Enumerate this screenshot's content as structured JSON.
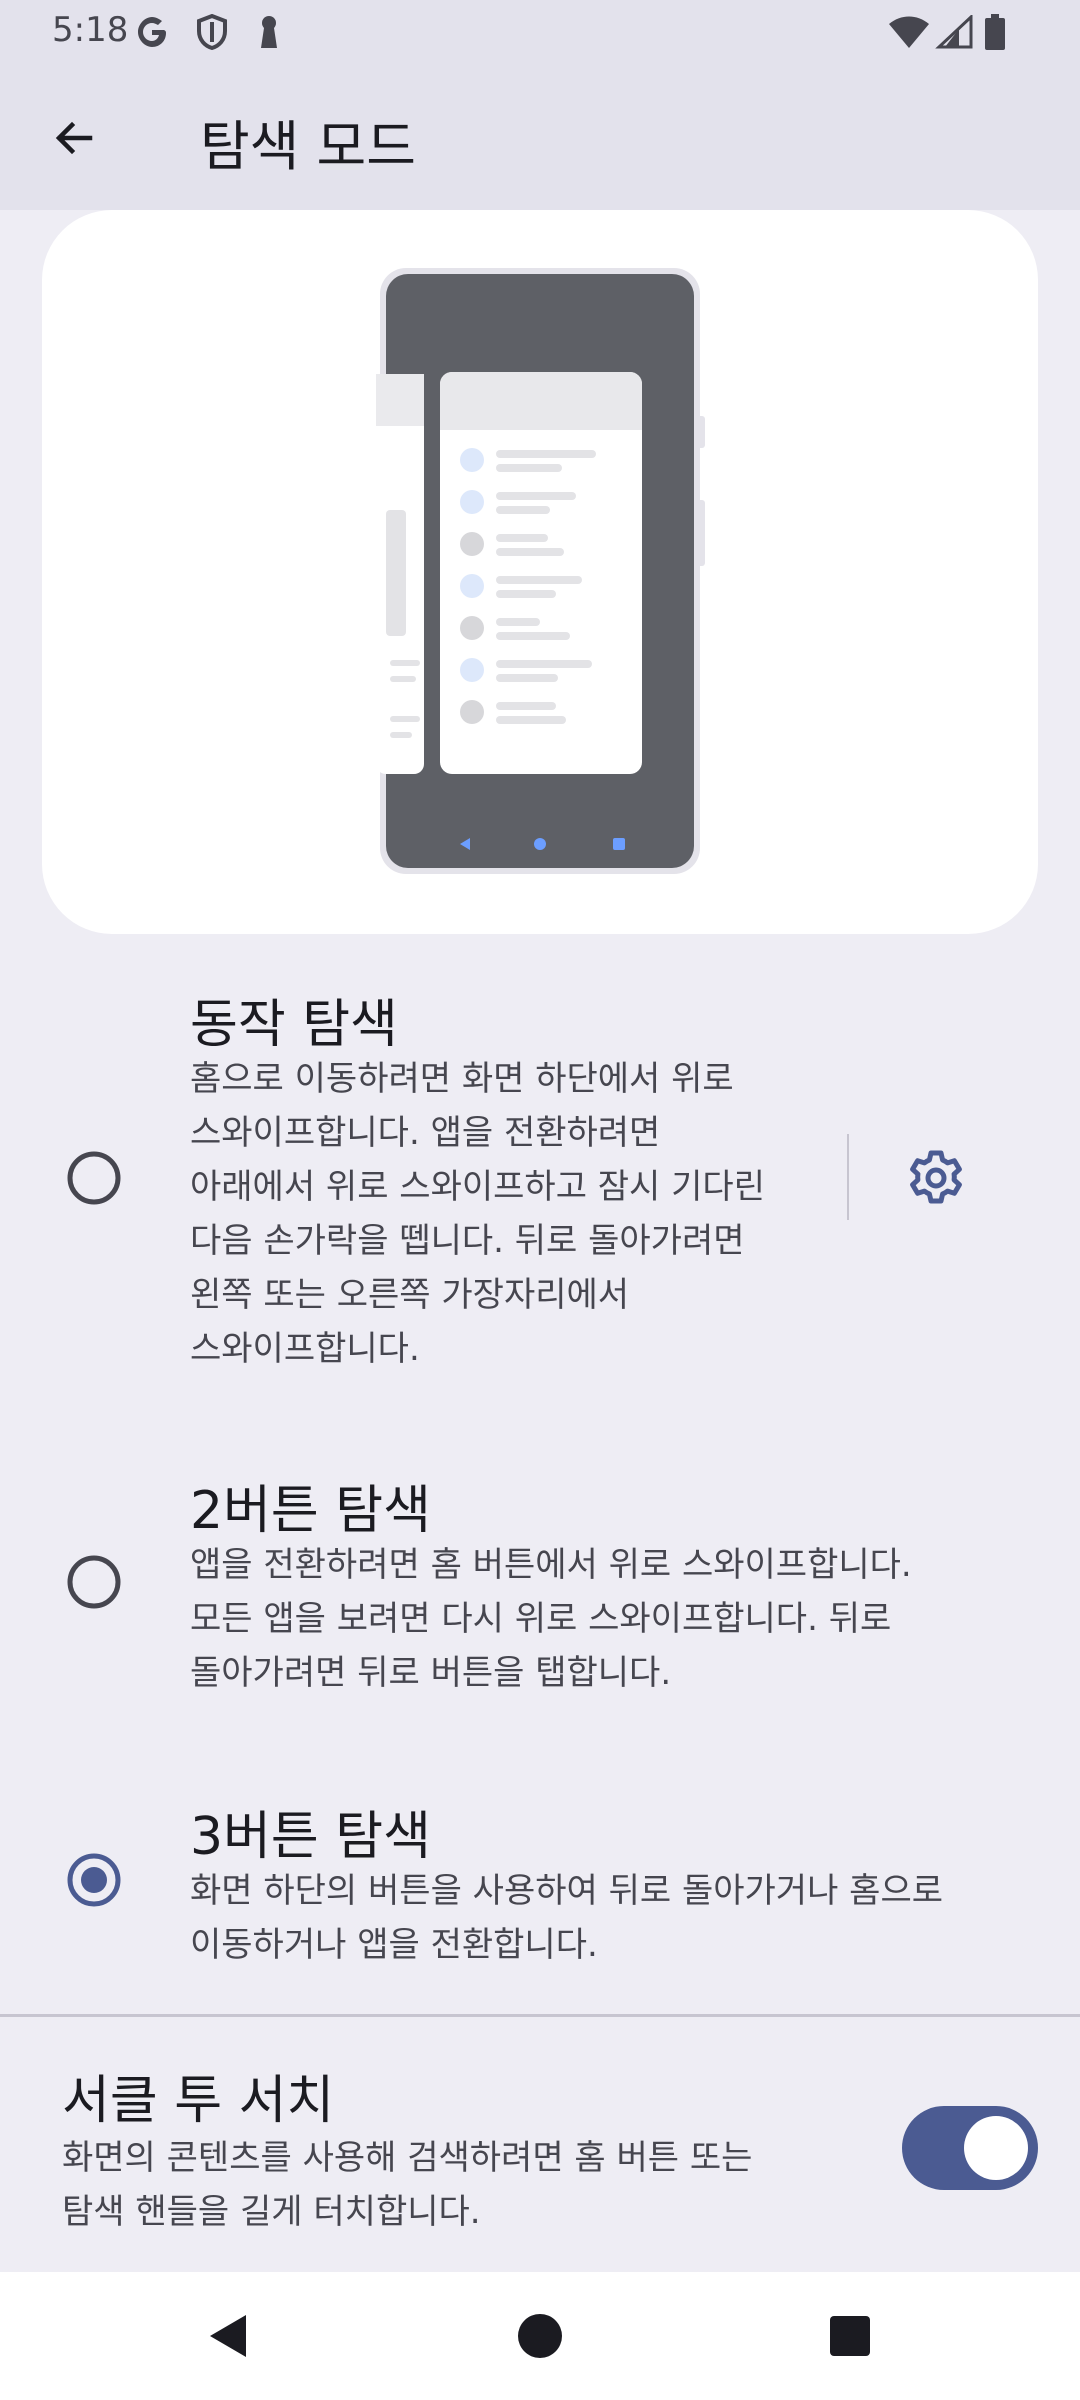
{
  "status_bar": {
    "time": "5:18",
    "left_icons": [
      "google-icon",
      "shield-icon",
      "keyhole-icon"
    ],
    "right_icons": [
      "wifi-icon",
      "signal-icon",
      "battery-icon"
    ]
  },
  "app_bar": {
    "title": "탐색 모드"
  },
  "options": [
    {
      "title": "동작 탐색",
      "description_lines": [
        "홈으로 이동하려면 화면 하단에서 위로",
        "스와이프합니다. 앱을 전환하려면",
        "아래에서 위로 스와이프하고 잠시 기다린",
        "다음 손가락을 뗍니다. 뒤로 돌아가려면",
        "왼쪽 또는 오른쪽 가장자리에서",
        "스와이프합니다."
      ],
      "selected": false,
      "has_settings": true
    },
    {
      "title": "2버튼 탐색",
      "description_lines": [
        "앱을 전환하려면 홈 버튼에서 위로 스와이프합니다.",
        "모든 앱을 보려면 다시 위로 스와이프합니다. 뒤로",
        "돌아가려면 뒤로 버튼을 탭합니다."
      ],
      "selected": false,
      "has_settings": false
    },
    {
      "title": "3버튼 탐색",
      "description_lines": [
        "화면 하단의 버튼을 사용하여 뒤로 돌아가거나 홈으로",
        "이동하거나 앱을 전환합니다."
      ],
      "selected": true,
      "has_settings": false
    }
  ],
  "circle_to_search": {
    "title": "서클 투 서치",
    "description_lines": [
      "화면의 콘텐츠를 사용해 검색하려면 홈 버튼 또는",
      "탐색 핸들을 길게 터치합니다."
    ],
    "enabled": true
  },
  "colors": {
    "accent": "#4b5b92",
    "background": "#eeedf4",
    "app_bar": "#e3e2ec",
    "card": "#ffffff"
  },
  "nav_bar": {
    "icons": [
      "back-triangle-icon",
      "home-circle-icon",
      "recents-square-icon"
    ]
  }
}
